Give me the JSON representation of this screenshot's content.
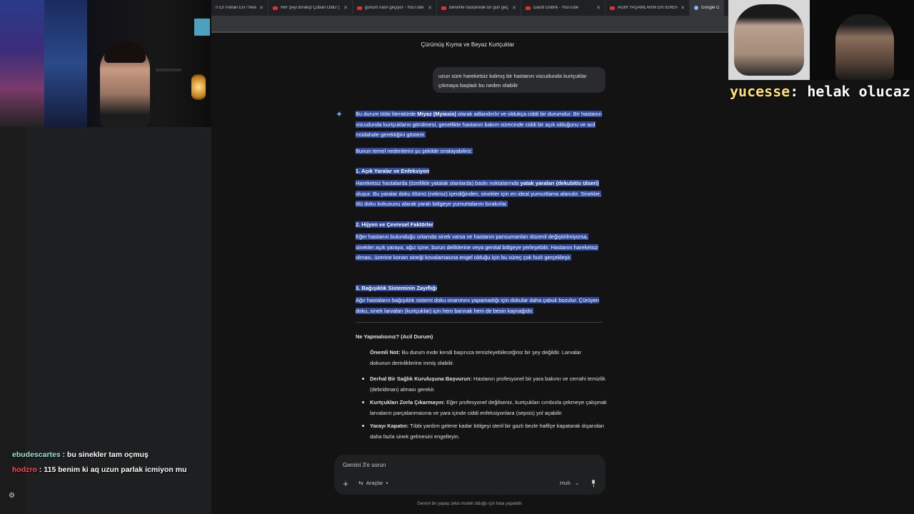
{
  "tabs": [
    {
      "label": "n En Pahalı Evi / New Y"
    },
    {
      "label": "Her Şeyi Bırakıp Çoban Oldu! | "
    },
    {
      "label": "günüm nasıl geçiyor - YouTube"
    },
    {
      "label": "Benimle hastanede bir gün geç"
    },
    {
      "label": "David Dobrik - YouTube"
    },
    {
      "label": "AĞIR YAŞAMLARIN EN İĞRENÇ"
    },
    {
      "label": "Google Gem"
    }
  ],
  "chat": {
    "title": "Çürümüş Kıyma ve Beyaz Kurtçuklar",
    "user_message": "uzun süre hareketsiz kalmış bir hastanın vücudunda kurtçuklar çıkmaya başladı bu neden olabilir",
    "response": {
      "intro_a": "Bu durum tıbbi literatürde ",
      "intro_b": "Miyaz (Myiasis)",
      "intro_c": " olarak adlandırılır ve oldukça ciddi bir durumdur. Bir hastanın vücudunda kurtçukların görülmesi, genellikle hastanın bakım sürecinde ciddi bir açık olduğunu ve acil müdahale gerektiğini gösterir.",
      "reasons_intro": "Bunun temel nedenlerini şu şekilde sıralayabiliriz:",
      "s1_title": "1. Açık Yaralar ve Enfeksiyon",
      "s1_a": "Hareketsiz hastalarda (özellikle yatalak olanlarda) baskı noktalarında ",
      "s1_b": "yatak yaraları (dekubitis ülseri)",
      "s1_c": " oluşur. Bu yaralar doku ölümü (nekroz) içerdiğinden, sinekler için en ideal yumurtlama alanıdır. Sinekler, ölü doku kokusunu alarak yaralı bölgeye yumurtalarını bırakırlar.",
      "s2_title": "2. Hijyen ve Çevresel Faktörler",
      "s2_text": "Eğer hastanın bulunduğu ortamda sinek varsa ve hastanın pansumanları düzenli değiştirilmiyorsa, sinekler açık yaraya, ağız içine, burun deliklerine veya genital bölgeye yerleşebilir. Hastanın hareketsiz olması, üzerine konan sineği kovalamasına engel olduğu için bu süreç çok hızlı gerçekleşir.",
      "s3_title": "3. Bağışıklık Sisteminin Zayıflığı",
      "s3_text": "Ağır hastaların bağışıklık sistemi doku onarımını yapamadığı için dokular daha çabuk bozulur. Çürüyen doku, sinek larvaları (kurtçuklar) için hem barınak hem de besin kaynağıdır.",
      "todo_title": "Ne Yapmalısınız? (Acil Durum)",
      "note_b": "Önemli Not:",
      "note_t": " Bu durum evde kendi başınıza temizleyebileceğiniz bir şey değildir. Larvalar dokunun derinliklerine inmiş olabilir.",
      "b1_b": "Derhal Bir Sağlık Kuruluşuna Başvurun:",
      "b1_t": " Hastanın profesyonel bir yara bakımı ve cerrahi temizlik (debridman) alması gerekir.",
      "b2_b": "Kurtçukları Zorla Çıkarmayın:",
      "b2_t": " Eğer profesyonel değilseniz, kurtçukları cımbızla çekmeye çalışmak larvaların parçalanmasına ve yara içinde ciddi enfeksiyonlara (sepsis) yol açabilir.",
      "b3_b": "Yarayı Kapatın:",
      "b3_t": " Tıbbi yardım gelene kadar bölgeyi steril bir gazlı bezle hafifçe kapatarak dışarıdan daha fazla sinek gelmesini engelleyin."
    }
  },
  "input": {
    "placeholder": "Gemini 3'e sorun",
    "tools_label": "Araçlar",
    "model_label": "Hızlı",
    "disclaimer": "Gemini bir yapay zeka modeli olduğu için hata yapabilir."
  },
  "webcam_caption": {
    "user": "yucesse",
    "text": ": helak olucaz"
  },
  "stream_chat": [
    {
      "user": "ebudescartes",
      "message": "bu sinekler tam oçmuş"
    },
    {
      "user": "hodzro",
      "message": "115 benim ki aq uzun parlak icmiyon mu"
    }
  ],
  "colors": {
    "highlight": "#2f4a9e",
    "background": "#131314",
    "user1": "#9ee6cf",
    "user2": "#ff4a5a"
  }
}
